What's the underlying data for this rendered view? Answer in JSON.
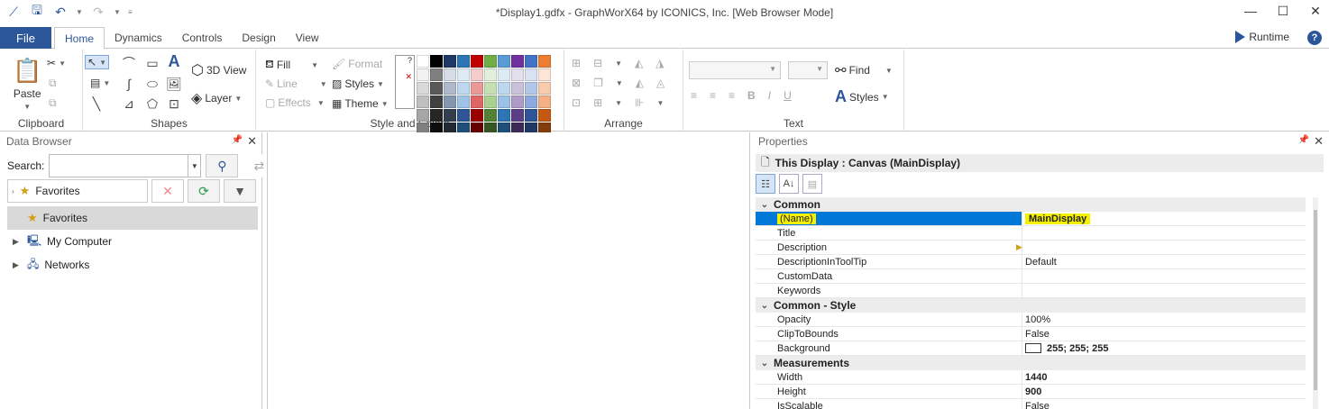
{
  "window": {
    "title": "*Display1.gdfx - GraphWorX64 by ICONICS, Inc. [Web Browser Mode]"
  },
  "menu": {
    "file": "File",
    "tabs": [
      "Home",
      "Dynamics",
      "Controls",
      "Design",
      "View"
    ],
    "runtime": "Runtime"
  },
  "ribbon": {
    "clipboard": {
      "paste": "Paste",
      "label": "Clipboard"
    },
    "shapes": {
      "view3d": "3D View",
      "layer": "Layer",
      "label": "Shapes"
    },
    "style": {
      "fill": "Fill",
      "line": "Line",
      "effects": "Effects",
      "format": "Format",
      "styles": "Styles",
      "theme": "Theme",
      "label": "Style and Colors"
    },
    "arrange": {
      "label": "Arrange"
    },
    "text": {
      "find": "Find",
      "styles": "Styles",
      "label": "Text",
      "bold": "B",
      "italic": "I",
      "underline": "U"
    }
  },
  "palette": [
    "#ffffff",
    "#000000",
    "#1f3864",
    "#2e75b6",
    "#c00000",
    "#70ad47",
    "#5b9bd5",
    "#7030a0",
    "#4472c4",
    "#ed7d31",
    "#f2f2f2",
    "#7f7f7f",
    "#d6dce5",
    "#deebf7",
    "#f4cccc",
    "#e2efda",
    "#ddebf7",
    "#e4dfec",
    "#d9e1f2",
    "#fce4d6",
    "#d9d9d9",
    "#595959",
    "#adb9ca",
    "#bdd7ee",
    "#ea9999",
    "#c6e0b4",
    "#bdd7ee",
    "#c9c1d9",
    "#b4c6e7",
    "#f8cbad",
    "#bfbfbf",
    "#404040",
    "#8497b0",
    "#9dc3e6",
    "#e06666",
    "#a9d08e",
    "#9bc2e6",
    "#ae9cc6",
    "#8ea9db",
    "#f4b084",
    "#a6a6a6",
    "#262626",
    "#333f4f",
    "#2f5597",
    "#990000",
    "#548235",
    "#2e75b6",
    "#5b3f86",
    "#2f5597",
    "#c65911",
    "#808080",
    "#0d0d0d",
    "#222a35",
    "#1f4e79",
    "#660000",
    "#375623",
    "#1f4e79",
    "#3d2a59",
    "#203864",
    "#833c0b",
    "#c00000",
    "#ff0000",
    "#ffc000",
    "#ffff00",
    "#92d050",
    "#00b050",
    "#00b0f0",
    "#0070c0",
    "#002060",
    "#7030a0"
  ],
  "data_browser": {
    "title": "Data Browser",
    "search_label": "Search:",
    "search_value": "",
    "favorites_combo": "Favorites",
    "tree": [
      {
        "label": "Favorites",
        "selected": true,
        "expandable": false
      },
      {
        "label": "My Computer",
        "selected": false,
        "expandable": true
      },
      {
        "label": "Networks",
        "selected": false,
        "expandable": true
      }
    ]
  },
  "properties": {
    "title": "Properties",
    "object_title": "This Display : Canvas (MainDisplay)",
    "categories": [
      {
        "name": "Common",
        "rows": [
          {
            "key": "(Name)",
            "value": "MainDisplay",
            "selected": true
          },
          {
            "key": "Title",
            "value": ""
          },
          {
            "key": "Description",
            "value": ""
          },
          {
            "key": "DescriptionInToolTip",
            "value": "Default"
          },
          {
            "key": "CustomData",
            "value": ""
          },
          {
            "key": "Keywords",
            "value": ""
          }
        ]
      },
      {
        "name": "Common - Style",
        "rows": [
          {
            "key": "Opacity",
            "value": "100%"
          },
          {
            "key": "ClipToBounds",
            "value": "False"
          },
          {
            "key": "Background",
            "value": "255; 255; 255",
            "swatch": "#ffffff",
            "bold": true
          }
        ]
      },
      {
        "name": "Measurements",
        "rows": [
          {
            "key": "Width",
            "value": "1440",
            "bold": true
          },
          {
            "key": "Height",
            "value": "900",
            "bold": true
          },
          {
            "key": "IsScalable",
            "value": "False"
          }
        ]
      }
    ]
  }
}
